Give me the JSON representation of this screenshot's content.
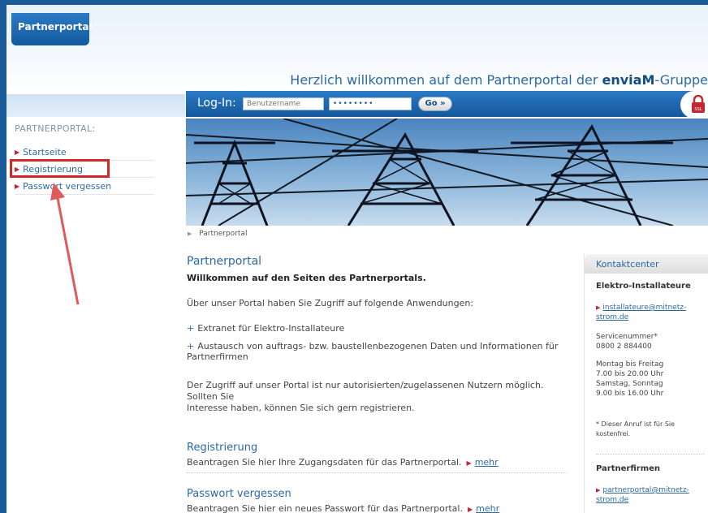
{
  "header": {
    "brand_tab": "Partnerportal",
    "welcome_prefix": "Herzlich willkommen auf dem Partnerportal der ",
    "welcome_brand": "enviaM",
    "welcome_suffix": "-Gruppe"
  },
  "login": {
    "label": "Log-In:",
    "username_placeholder": "Benutzername",
    "password_value": "••••••••",
    "go_label": "Go »",
    "ssl_icon": "lock-icon",
    "ssl_text": "SSL"
  },
  "sidebar": {
    "title": "PARTNERPORTAL:",
    "items": [
      {
        "label": "Startseite"
      },
      {
        "label": "Registrierung"
      },
      {
        "label": "Passwort vergessen"
      }
    ]
  },
  "breadcrumb": {
    "items": [
      "Partnerportal"
    ]
  },
  "main": {
    "title": "Partnerportal",
    "welcome_heading": "Willkommen auf den Seiten des Partnerportals.",
    "intro": "Über unser Portal haben Sie Zugriff auf folgende Anwendungen:",
    "bullets": [
      "Extranet für Elektro-Installateure",
      "Austausch von auftrags- bzw. baustellenbezogenen Daten und Informationen für Partnerfirmen"
    ],
    "access_text_1": "Der Zugriff auf unser Portal ist nur autorisierten/zugelassenen Nutzern möglich. Sollten Sie",
    "access_text_2": "Interesse haben, können Sie sich gern registrieren.",
    "sections": [
      {
        "title": "Registrierung",
        "text": "Beantragen Sie hier Ihre Zugangsdaten für das Partnerportal.",
        "link": "mehr"
      },
      {
        "title": "Passwort vergessen",
        "text": "Beantragen Sie hier ein neues Passwort für das Partnerportal.",
        "link": "mehr"
      }
    ]
  },
  "kontakt": {
    "header": "Kontaktcenter",
    "group1": {
      "title": "Elektro-Installateure",
      "email_line1": "installateure@mitnetz-",
      "email_line2": "strom.de",
      "service_label": "Servicenummer*",
      "service_number": "0800 2 884400",
      "hours_1": "Montag bis Freitag",
      "hours_2": "7.00 bis 20.00 Uhr",
      "hours_3": "Samstag, Sonntag",
      "hours_4": "9.00 bis 16.00 Uhr",
      "note_1": "* Dieser Anruf ist für Sie",
      "note_2": "kostenfrei."
    },
    "group2": {
      "title": "Partnerfirmen",
      "email_line1": "partnerportal@mitnetz-",
      "email_line2": "strom.de"
    }
  },
  "colors": {
    "brand_blue": "#1a5a99",
    "link_blue": "#2a6aa5",
    "accent_red": "#c3262e",
    "highlight_red": "#d6262a"
  }
}
